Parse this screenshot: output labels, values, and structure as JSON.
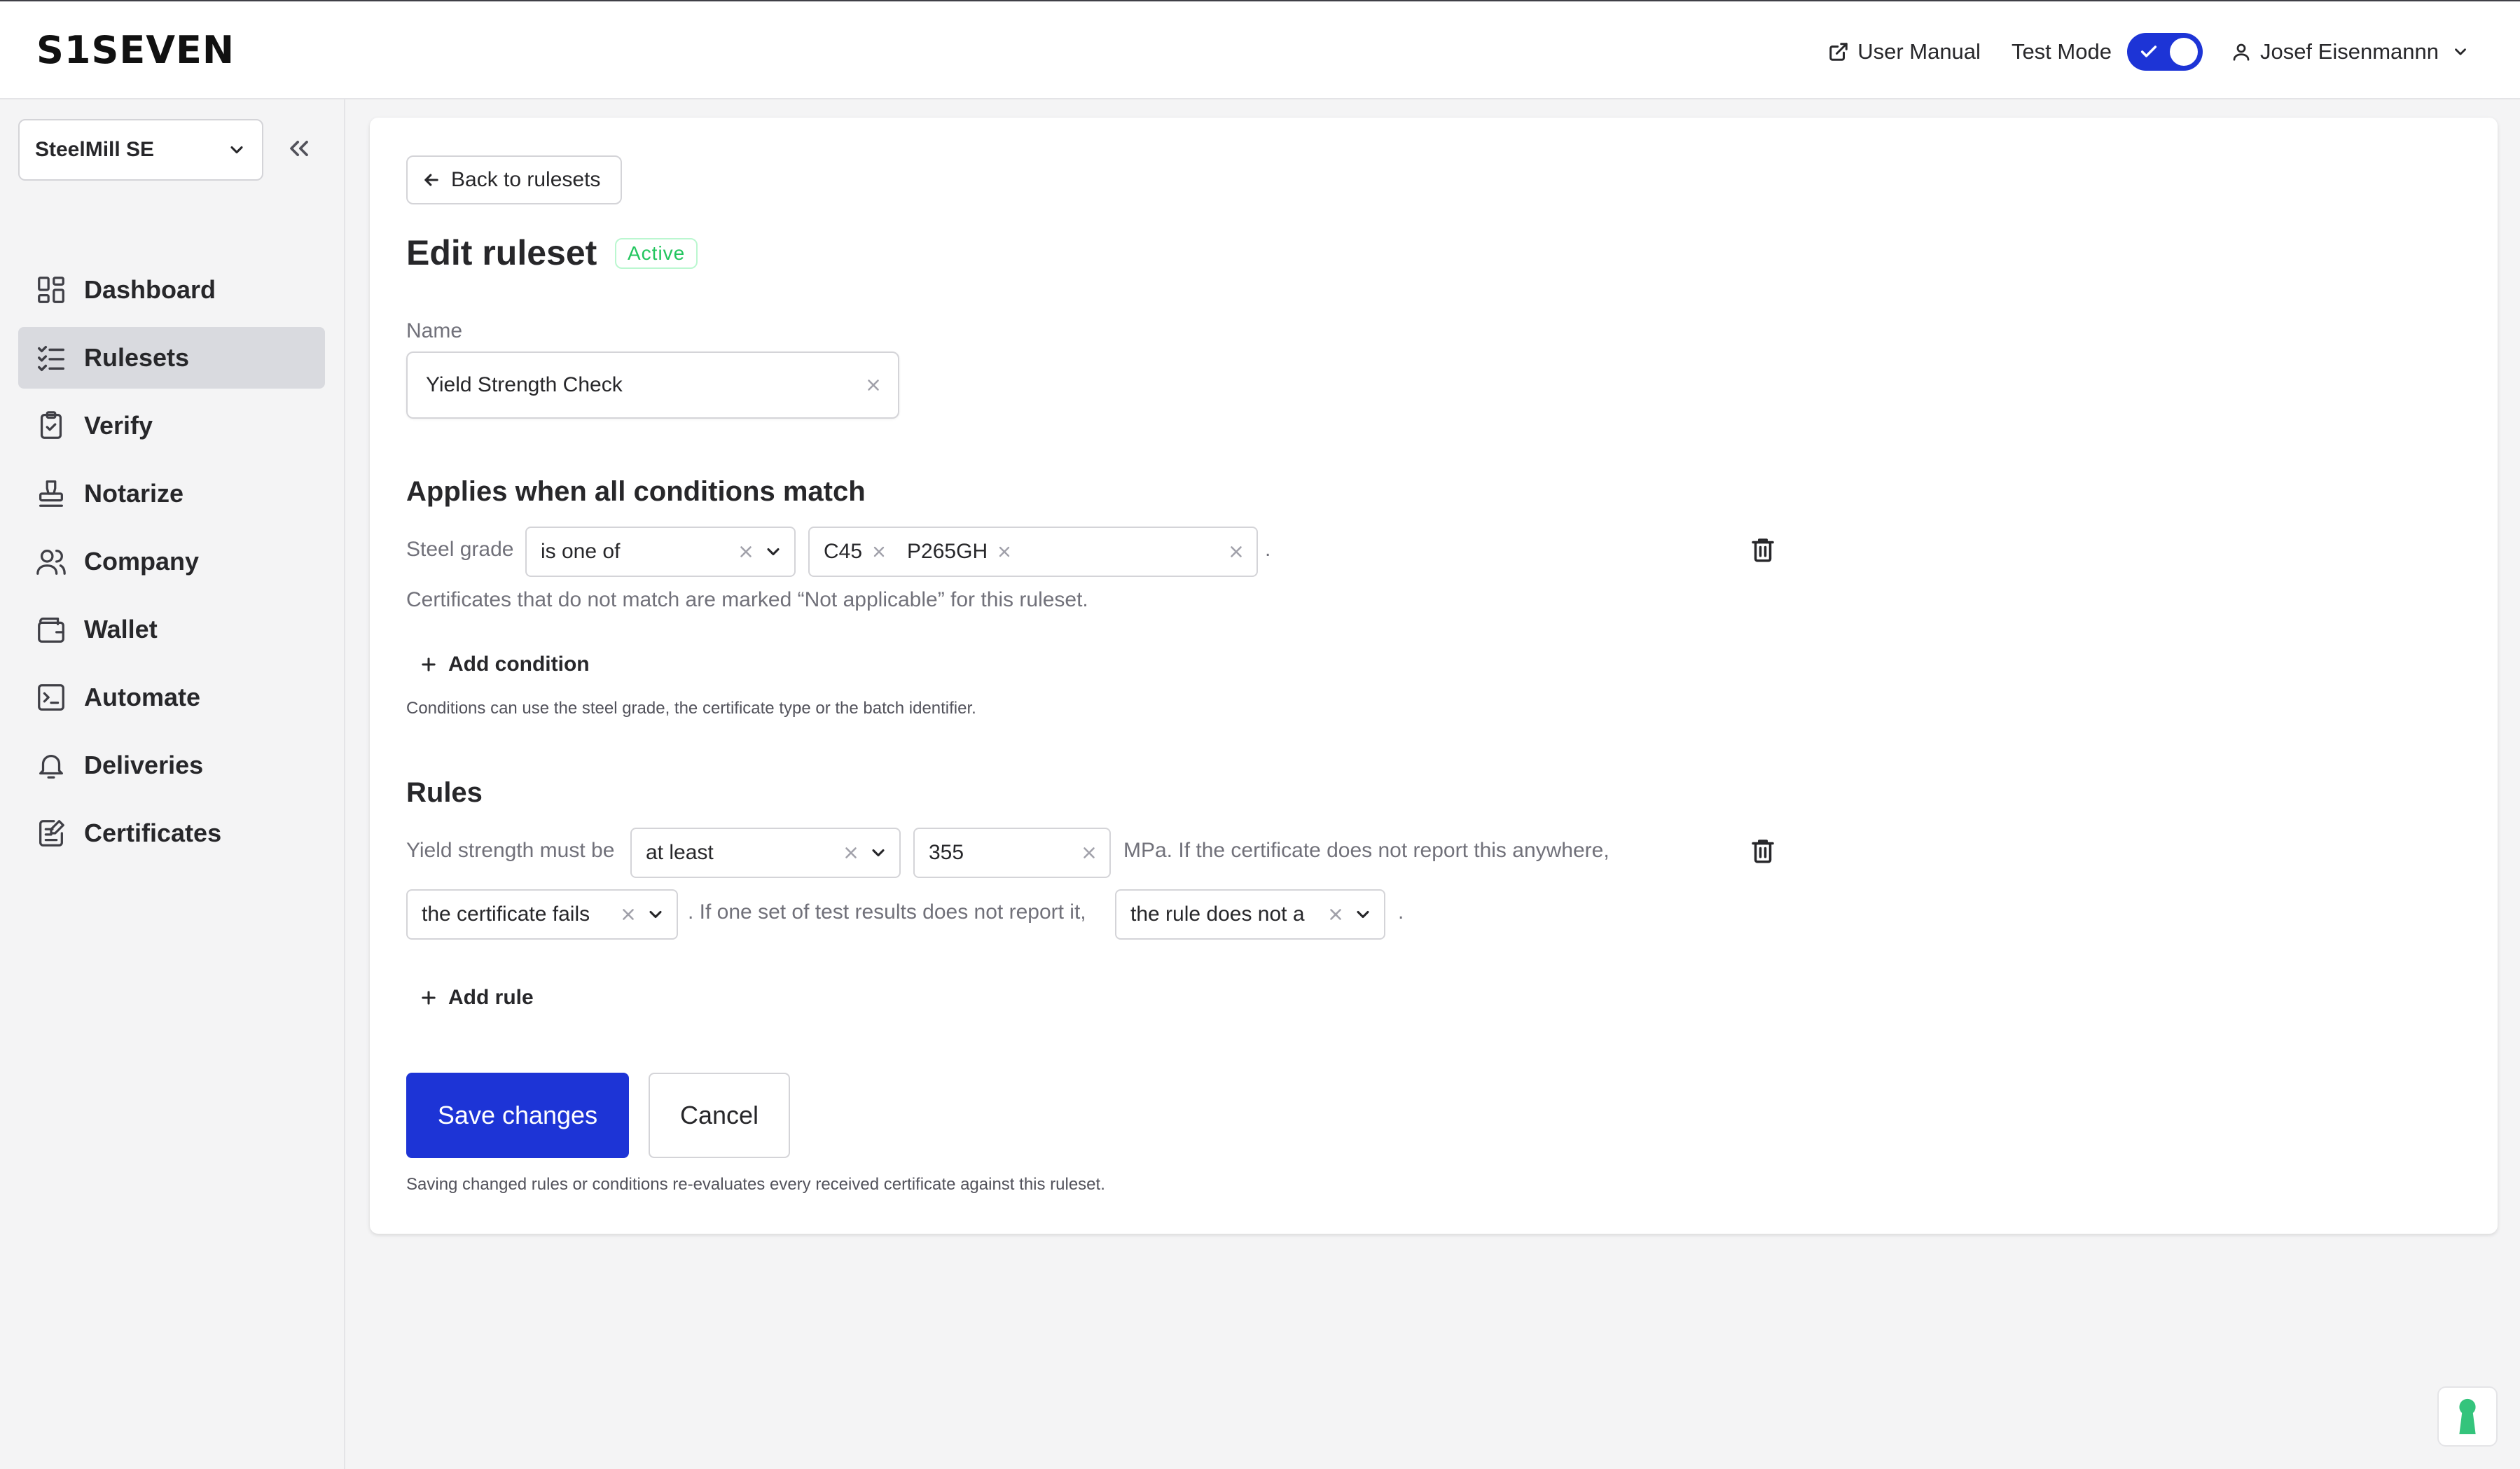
{
  "app": {
    "logo": "S1SEVEN"
  },
  "topbar": {
    "user_manual": "User Manual",
    "test_mode_label": "Test Mode",
    "test_mode_on": true,
    "user_name": "Josef Eisenmannn"
  },
  "sidebar": {
    "org": "SteelMill SE",
    "items": [
      {
        "label": "Dashboard",
        "icon": "dashboard-icon"
      },
      {
        "label": "Rulesets",
        "icon": "checklist-icon",
        "active": true
      },
      {
        "label": "Verify",
        "icon": "clipboard-check-icon"
      },
      {
        "label": "Notarize",
        "icon": "stamp-icon"
      },
      {
        "label": "Company",
        "icon": "users-icon"
      },
      {
        "label": "Wallet",
        "icon": "wallet-icon"
      },
      {
        "label": "Automate",
        "icon": "terminal-icon"
      },
      {
        "label": "Deliveries",
        "icon": "bell-icon"
      },
      {
        "label": "Certificates",
        "icon": "certificate-edit-icon"
      }
    ]
  },
  "main": {
    "back_label": "Back to rulesets",
    "title": "Edit ruleset",
    "status": "Active",
    "name_label": "Name",
    "name_value": "Yield Strength Check",
    "conditions": {
      "title": "Applies when all conditions match",
      "field_label": "Steel grade",
      "operator": "is one of",
      "values": [
        "C45",
        "P265GH"
      ],
      "period": ".",
      "note": "Certificates that do not match are marked “Not applicable” for this ruleset.",
      "add_label": "Add condition",
      "hint": "Conditions can use the steel grade, the certificate type or the batch identifier."
    },
    "rules": {
      "title": "Rules",
      "prefix": "Yield strength must be",
      "operator": "at least",
      "value": "355",
      "unit_text": "MPa.  If the certificate does not report this anywhere,",
      "missing_action": "the certificate fails",
      "mid_text": ".  If one set of test results does not report it,",
      "partial_action": "the rule does not a",
      "period": ".",
      "add_label": "Add rule"
    },
    "save_label": "Save changes",
    "cancel_label": "Cancel",
    "footer_hint": "Saving changed rules or conditions re-evaluates every received certificate against this ruleset."
  },
  "colors": {
    "primary": "#1d34d6",
    "active_badge": "#22c55e"
  }
}
